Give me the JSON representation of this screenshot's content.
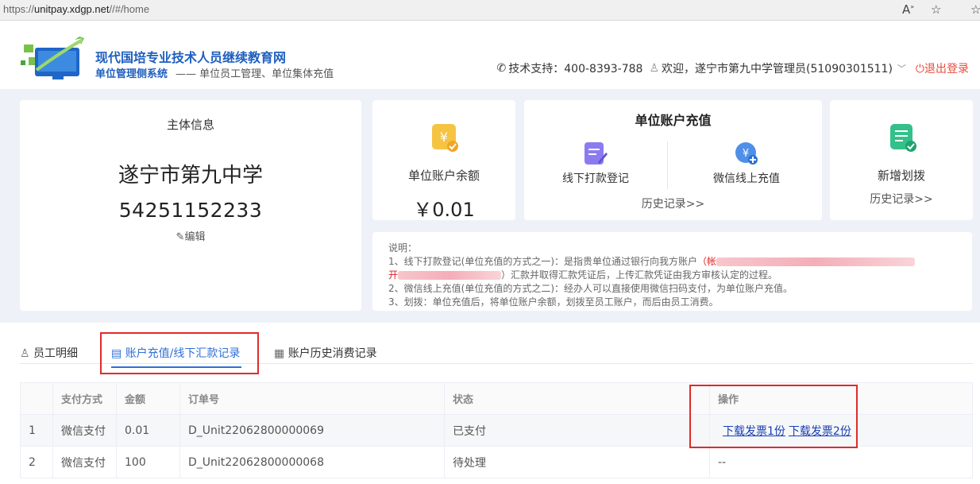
{
  "browser": {
    "url_prefix": "https://",
    "url_host": "unitpay.xdgp.net",
    "url_path": "//#/home"
  },
  "header": {
    "site_title": "现代国培专业技术人员继续教育网",
    "system_name": "单位管理侧系统",
    "system_desc": "—— 单位员工管理、单位集体充值",
    "support": "技术支持：400-8393-788",
    "welcome": "欢迎，遂宁市第九中学管理员(51090301511)",
    "logout": "退出登录"
  },
  "main_card": {
    "heading": "主体信息",
    "org_name": "遂宁市第九中学",
    "org_code": "54251152233",
    "edit": "编辑"
  },
  "balance_card": {
    "label": "单位账户余额",
    "amount": "￥0.01"
  },
  "recharge_card": {
    "heading": "单位账户充值",
    "offline": "线下打款登记",
    "wechat": "微信线上充值",
    "history": "历史记录>>"
  },
  "alloc_card": {
    "label": "新增划拨",
    "history": "历史记录>>"
  },
  "notes": {
    "title": "说明：",
    "line1_a": "1、线下打款登记(单位充值的方式之一)：是指贵单位通过银行向我方账户",
    "line1_red_a": "（帐",
    "line2_red": "开",
    "line2_b": "）汇款并取得汇款凭证后，上传汇款凭证由我方审核认定的过程。",
    "line3": "2、微信线上充值(单位充值的方式之二)：经办人可以直接使用微信扫码支付，为单位账户充值。",
    "line4": "3、划拨：单位充值后，将单位账户余额，划拨至员工账户，而后由员工消费。"
  },
  "tabs": [
    {
      "label": "员工明细"
    },
    {
      "label": "账户充值/线下汇款记录"
    },
    {
      "label": "账户历史消费记录"
    }
  ],
  "table": {
    "headers": [
      "",
      "支付方式",
      "金额",
      "订单号",
      "状态",
      "操作"
    ],
    "rows": [
      {
        "idx": "1",
        "method": "微信支付",
        "amount": "0.01",
        "order": "D_Unit22062800000069",
        "status": "已支付",
        "op1": "下载发票1份",
        "op2": "下载发票2份"
      },
      {
        "idx": "2",
        "method": "微信支付",
        "amount": "100",
        "order": "D_Unit22062800000068",
        "status": "待处理",
        "op_text": "--"
      }
    ]
  },
  "colors": {
    "brand_blue": "#1f5fbf",
    "active_tab": "#2f6fd8",
    "logout_red": "#e84b3c",
    "highlight_red": "#e02b2b"
  }
}
